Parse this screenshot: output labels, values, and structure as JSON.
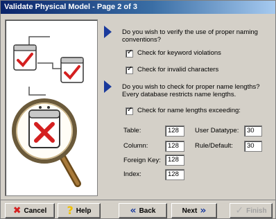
{
  "window": {
    "title": "Validate Physical Model - Page 2 of 3"
  },
  "naming": {
    "question": "Do you wish to verify the use of proper naming conventions?",
    "keyword_label": "Check for keyword violations",
    "invalid_chars_label": "Check for invalid characters",
    "keyword_checked": true,
    "invalid_chars_checked": true
  },
  "lengths": {
    "question": "Do you wish to check for proper name lengths? Every database restricts name lengths.",
    "exceeding_label": "Check for name lengths exceeding:",
    "exceeding_checked": true,
    "fields": {
      "table_label": "Table:",
      "table_value": "128",
      "column_label": "Column:",
      "column_value": "128",
      "foreign_key_label": "Foreign Key:",
      "foreign_key_value": "128",
      "index_label": "Index:",
      "index_value": "128",
      "user_datatype_label": "User Datatype:",
      "user_datatype_value": "30",
      "rule_default_label": "Rule/Default:",
      "rule_default_value": "30"
    }
  },
  "buttons": {
    "cancel_label": "Cancel",
    "help_label": "Help",
    "back_label": "Back",
    "next_label": "Next",
    "finish_label": "Finish"
  },
  "colors": {
    "accent": "#1a3a9c",
    "check_red": "#d42020",
    "help_yellow": "#f0c000"
  }
}
